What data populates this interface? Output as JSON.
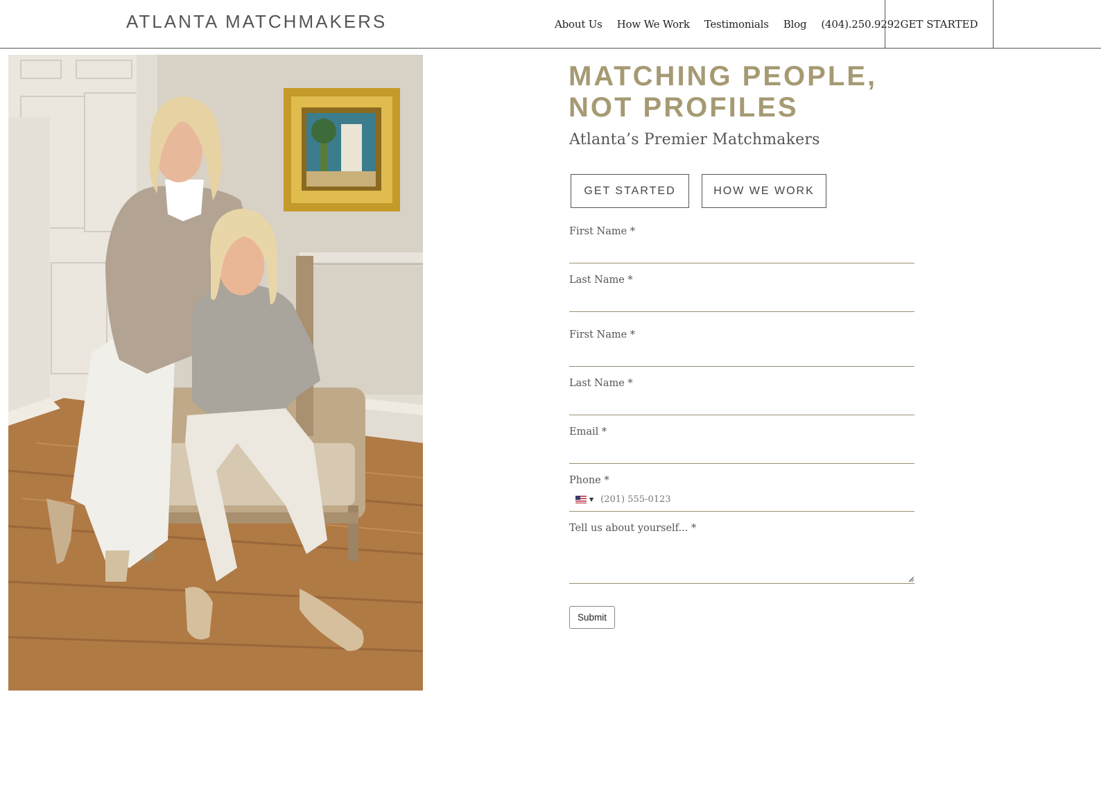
{
  "header": {
    "brand": "ATLANTA MATCHMAKERS",
    "nav": [
      "About Us",
      "How We Work",
      "Testimonials",
      "Blog",
      "(404).250.9292"
    ],
    "cta_label": "GET STARTED"
  },
  "photo": {
    "subject_icon": "two-women-seated-portrait-photo"
  },
  "hero": {
    "title_line1": "MATCHING PEOPLE,",
    "title_line2": "NOT PROFILES",
    "subtitle": "Atlanta’s Premier Matchmakers",
    "primary_button": "GET STARTED",
    "secondary_button": "HOW WE WORK"
  },
  "form": {
    "fields": [
      {
        "label": "First Name *",
        "value": ""
      },
      {
        "label": "Last Name *",
        "value": ""
      },
      {
        "label": "First Name *",
        "value": ""
      },
      {
        "label": "Last Name *",
        "value": ""
      },
      {
        "label": "Email *",
        "value": ""
      },
      {
        "label": "Phone *",
        "placeholder": "(201) 555-0123",
        "country_icon": "us-flag-icon"
      },
      {
        "label": "Tell us about yourself... *",
        "value": ""
      }
    ],
    "submit_label": "Submit"
  },
  "colors": {
    "accent": "#a59a73",
    "underline": "#9a9170",
    "text": "#555555"
  }
}
